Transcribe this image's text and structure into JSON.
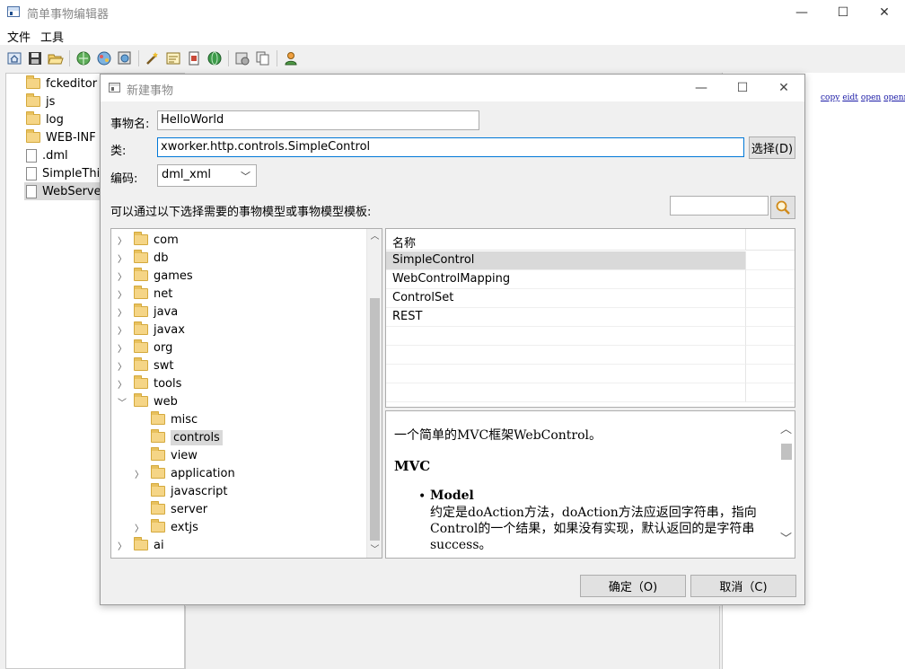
{
  "app": {
    "title": "简单事物编辑器",
    "minimize": "—",
    "maximize": "☐",
    "close": "✕"
  },
  "menu": [
    "文件",
    "工具"
  ],
  "left_tree": [
    {
      "label": "fckeditor",
      "icon": "folder-icon"
    },
    {
      "label": "js",
      "icon": "folder-icon"
    },
    {
      "label": "log",
      "icon": "folder-icon"
    },
    {
      "label": "WEB-INF",
      "icon": "folder-icon"
    },
    {
      "label": ".dml",
      "icon": "file-icon"
    },
    {
      "label": "SimpleThing",
      "icon": "file-icon"
    },
    {
      "label": "WebServer",
      "icon": "file-icon",
      "selected": true
    }
  ],
  "right_links": [
    "copy",
    "eidt",
    "open",
    "openr"
  ],
  "dialog": {
    "title": "新建事物",
    "name_label": "事物名:",
    "name_value": "HelloWorld",
    "class_label": "类:",
    "class_value": "xworker.http.controls.SimpleControl",
    "select_button": "选择(D)",
    "encoding_label": "编码:",
    "encoding_value": "dml_xml",
    "hint": "可以通过以下选择需要的事物模型或事物模型模板:",
    "search_value": "",
    "tree": [
      {
        "label": "com",
        "depth": 0,
        "expander": "collapsed"
      },
      {
        "label": "db",
        "depth": 0,
        "expander": "collapsed"
      },
      {
        "label": "games",
        "depth": 0,
        "expander": "collapsed"
      },
      {
        "label": "net",
        "depth": 0,
        "expander": "collapsed"
      },
      {
        "label": "java",
        "depth": 0,
        "expander": "collapsed"
      },
      {
        "label": "javax",
        "depth": 0,
        "expander": "collapsed"
      },
      {
        "label": "org",
        "depth": 0,
        "expander": "collapsed"
      },
      {
        "label": "swt",
        "depth": 0,
        "expander": "collapsed"
      },
      {
        "label": "tools",
        "depth": 0,
        "expander": "collapsed"
      },
      {
        "label": "web",
        "depth": 0,
        "expander": "expanded"
      },
      {
        "label": "misc",
        "depth": 1,
        "expander": "none"
      },
      {
        "label": "controls",
        "depth": 1,
        "expander": "none",
        "selected": true
      },
      {
        "label": "view",
        "depth": 1,
        "expander": "none"
      },
      {
        "label": "application",
        "depth": 1,
        "expander": "collapsed"
      },
      {
        "label": "javascript",
        "depth": 1,
        "expander": "none"
      },
      {
        "label": "server",
        "depth": 1,
        "expander": "none"
      },
      {
        "label": "extjs",
        "depth": 1,
        "expander": "collapsed"
      },
      {
        "label": "ai",
        "depth": 0,
        "expander": "collapsed"
      }
    ],
    "table": {
      "header": "名称",
      "rows": [
        "SimpleControl",
        "WebControlMapping",
        "ControlSet",
        "REST"
      ],
      "selected_row": 0
    },
    "description": {
      "intro": "一个简单的MVC框架WebControl。",
      "heading": "MVC",
      "bullet_title": "Model",
      "bullet_text": "约定是doAction方法，doAction方法应返回字符串，指向Control的一个结果，如果没有实现，默认返回的是字符串success。"
    },
    "ok_button": "确定（O)",
    "cancel_button": "取消（C)"
  }
}
